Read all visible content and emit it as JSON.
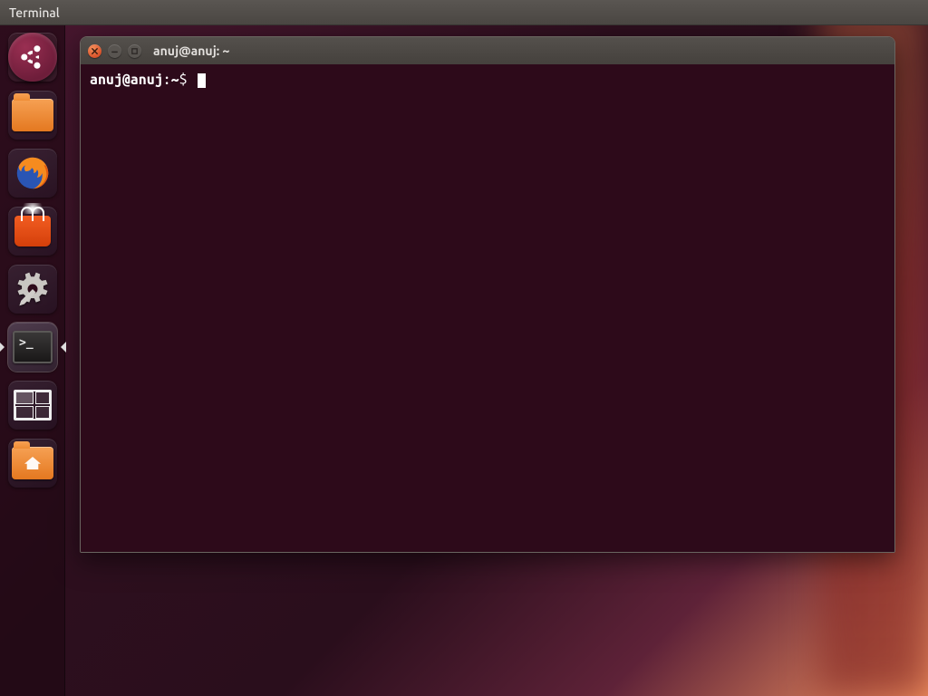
{
  "menubar": {
    "app_name": "Terminal"
  },
  "launcher": {
    "items": [
      {
        "name": "dash-home",
        "label": "Dash Home"
      },
      {
        "name": "files",
        "label": "Files"
      },
      {
        "name": "firefox",
        "label": "Firefox Web Browser"
      },
      {
        "name": "software-center",
        "label": "Ubuntu Software Center"
      },
      {
        "name": "settings",
        "label": "System Settings"
      },
      {
        "name": "terminal",
        "label": "Terminal",
        "active": true
      },
      {
        "name": "workspace-switcher",
        "label": "Workspace Switcher"
      },
      {
        "name": "home-folder",
        "label": "Home Folder"
      }
    ]
  },
  "window": {
    "title": "anuj@anuj: ~",
    "controls": {
      "close": "Close",
      "minimize": "Minimize",
      "maximize": "Maximize"
    }
  },
  "terminal": {
    "prompt_userhost": "anuj@anuj",
    "prompt_sep": ":",
    "prompt_path": "~",
    "prompt_symbol": "$",
    "input": ""
  },
  "colors": {
    "terminal_bg": "#2d0a1a",
    "close_button": "#d9522a",
    "accent_orange": "#e47820"
  }
}
